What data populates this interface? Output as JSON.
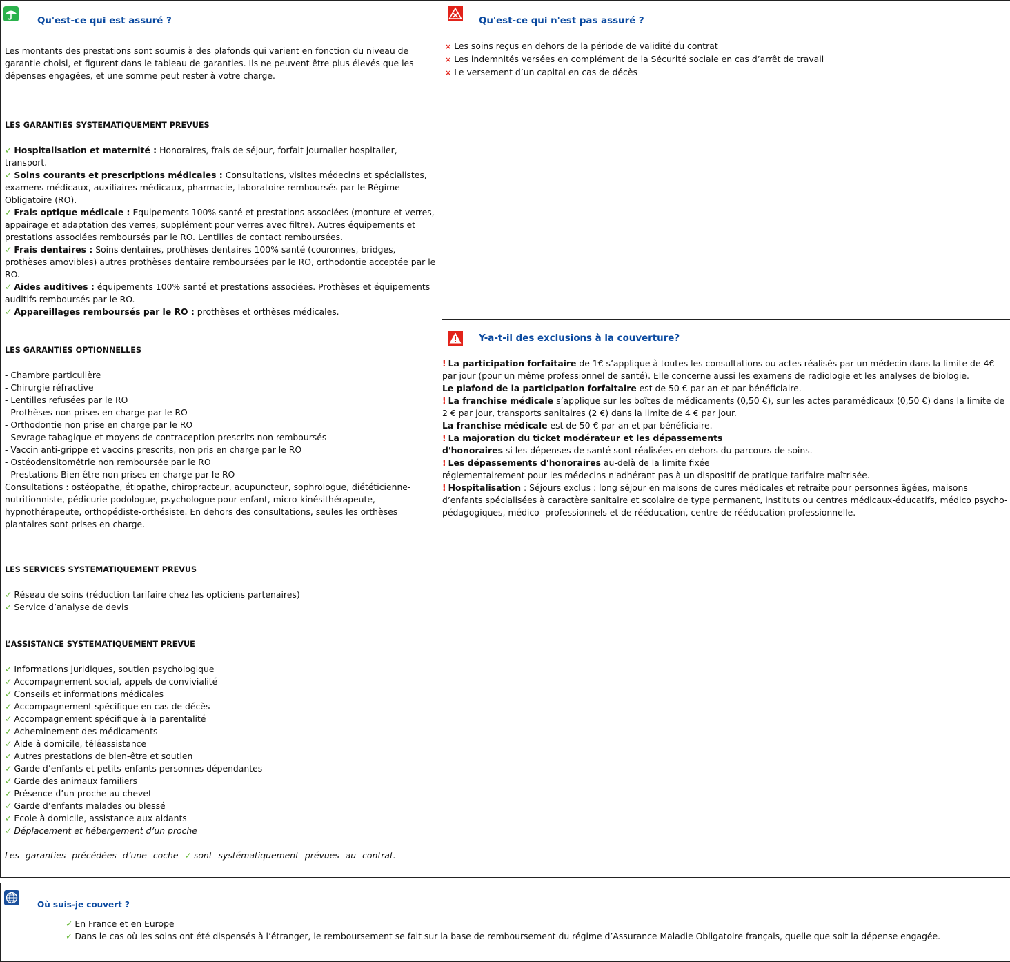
{
  "assured": {
    "title": "Qu'est-ce qui est assuré ?",
    "intro": "Les montants des prestations sont soumis à des plafonds qui varient en fonction du niveau de garantie choisi, et figurent dans le tableau de garanties. Ils ne peuvent être plus élevés que les dépenses engagées, et une somme peut rester à votre charge.",
    "systematic_title": "LES GARANTIES SYSTEMATIQUEMENT PREVUES",
    "systematic": [
      {
        "label": "Hospitalisation et maternité :",
        "text": " Honoraires, frais de séjour, forfait journalier hospitalier, transport."
      },
      {
        "label": "Soins courants et prescriptions médicales :",
        "text": " Consultations, visites médecins et spécialistes, examens médicaux, auxiliaires médicaux, pharmacie, laboratoire remboursés par le Régime Obligatoire (RO)."
      },
      {
        "label": "Frais optique médicale :",
        "text": " Equipements 100% santé et prestations associées (monture et verres, appairage et adaptation des verres, supplément pour verres avec filtre). Autres équipements et prestations associées remboursés par le RO. Lentilles de contact remboursées."
      },
      {
        "label": "Frais dentaires :",
        "text": " Soins dentaires, prothèses dentaires 100% santé (couronnes, bridges, prothèses amovibles) autres prothèses dentaire remboursées par le RO, orthodontie acceptée par le RO."
      },
      {
        "label": "Aides auditives :",
        "text": " équipements 100% santé et prestations associées. Prothèses et équipements auditifs remboursés par le RO."
      },
      {
        "label": "Appareillages remboursés par le RO :",
        "text": " prothèses et orthèses médicales."
      }
    ],
    "optional_title": "LES GARANTIES OPTIONNELLES",
    "optional": [
      "- Chambre particulière",
      "- Chirurgie réfractive",
      "- Lentilles refusées par le RO",
      "- Prothèses non prises en charge par le RO",
      "- Orthodontie non prise en charge par le RO",
      "- Sevrage tabagique et moyens de contraception prescrits non remboursés",
      "- Vaccin anti-grippe et vaccins prescrits, non pris en charge par le RO",
      "- Ostéodensitométrie non remboursée par le RO",
      "- Prestations Bien être non prises en charge par le RO"
    ],
    "optional_note": "Consultations : ostéopathe, étiopathe, chiropracteur, acupuncteur, sophrologue, diététicienne-nutritionniste, pédicurie-podologue, psychologue pour enfant, micro-kinésithérapeute, hypnothérapeute, orthopédiste-orthésiste. En dehors des consultations, seules les orthèses plantaires sont prises en charge.",
    "services_title": "LES SERVICES SYSTEMATIQUEMENT PREVUS",
    "services": [
      "Réseau de soins (réduction tarifaire chez les opticiens partenaires)",
      "Service d’analyse de devis"
    ],
    "assistance_title": "L’ASSISTANCE SYSTEMATIQUEMENT PREVUE",
    "assistance": [
      "Informations juridiques, soutien psychologique",
      "Accompagnement social, appels de convivialité",
      "Conseils et informations médicales",
      "Accompagnement spécifique en cas de décès",
      "Accompagnement spécifique à la parentalité",
      "Acheminement des médicaments",
      "Aide à domicile, téléassistance",
      "Autres prestations de bien-être et soutien",
      "Garde d’enfants et petits-enfants personnes dépendantes",
      "Garde des animaux familiers",
      "Présence d’un proche au chevet",
      "Garde d’enfants malades ou blessé",
      "Ecole à domicile, assistance aux aidants"
    ],
    "assistance_last": "Déplacement et hébergement d’un proche",
    "footnote_a": "Les garanties précédées d’une coche",
    "footnote_b": "sont systématiquement prévues au contrat."
  },
  "not_assured": {
    "title": "Qu'est-ce qui n'est pas assuré ?",
    "items": [
      "Les soins reçus en dehors de la période de validité du contrat",
      "Les indemnités versées  en  complément de la Sécurité sociale  en  cas d’arrêt de travail",
      "Le versement d’un capital en cas de décès"
    ]
  },
  "exclusions": {
    "title": "Y-a-t-il des exclusions à la couverture?",
    "p1_bold": "La participation forfaitaire",
    "p1_text": " de 1€ s’applique à toutes les consultations ou actes réalisés par un médecin dans la limite de 4€ par jour (pour un même professionnel de santé). Elle concerne aussi les examens de radiologie et les analyses de biologie.",
    "p2_bold": "Le plafond de la participation forfaitaire",
    "p2_text": " est de 50 € par an et par bénéficiaire.",
    "p3_bold": "La franchise médicale",
    "p3_text": " s’applique sur les boîtes de médicaments (0,50 €), sur les actes paramédicaux (0,50 €) dans la limite de 2 € par jour, transports sanitaires (2 €) dans la limite de 4 € par jour.",
    "p4_bold": "La franchise médicale",
    "p4_text": " est de 50 € par an et par bénéficiaire.",
    "p5_bold_a": "La majoration du ticket modérateur et les dépassements",
    "p5_bold_b": "d'honoraires",
    "p5_text": " si les dépenses de santé sont réalisées en dehors du parcours de soins.",
    "p6_bold": "Les dépassements d'honoraires",
    "p6_text_a": " au-delà de la limite fixée",
    "p6_text_b": "réglementairement pour les médecins n'adhérant pas à un dispositif de pratique tarifaire maîtrisée.",
    "p7_bold": "Hospitalisation",
    "p7_text": " : Séjours exclus : long séjour en maisons de cures médicales et retraite pour personnes âgées, maisons d’enfants spécialisées à caractère sanitaire et scolaire de type permanent, instituts ou centres médicaux-éducatifs, médico psycho-pédagogiques, médico- professionnels et de rééducation, centre de rééducation professionnelle."
  },
  "where": {
    "title": "Où suis-je couvert ?",
    "items": [
      "En France et en Europe",
      "Dans le cas où les soins ont été dispensés à l’étranger, le remboursement se fait sur la base de remboursement du régime d’Assurance Maladie Obligatoire français, quelle que soit la dépense engagée."
    ]
  },
  "symbols": {
    "check": "✓",
    "cross": "×",
    "bang": "!"
  },
  "colors": {
    "title": "#0b4aa0",
    "check": "#6dbb3f",
    "alert": "#e2231a",
    "globe": "#1a4f9c",
    "umbrella": "#2bb24c"
  }
}
